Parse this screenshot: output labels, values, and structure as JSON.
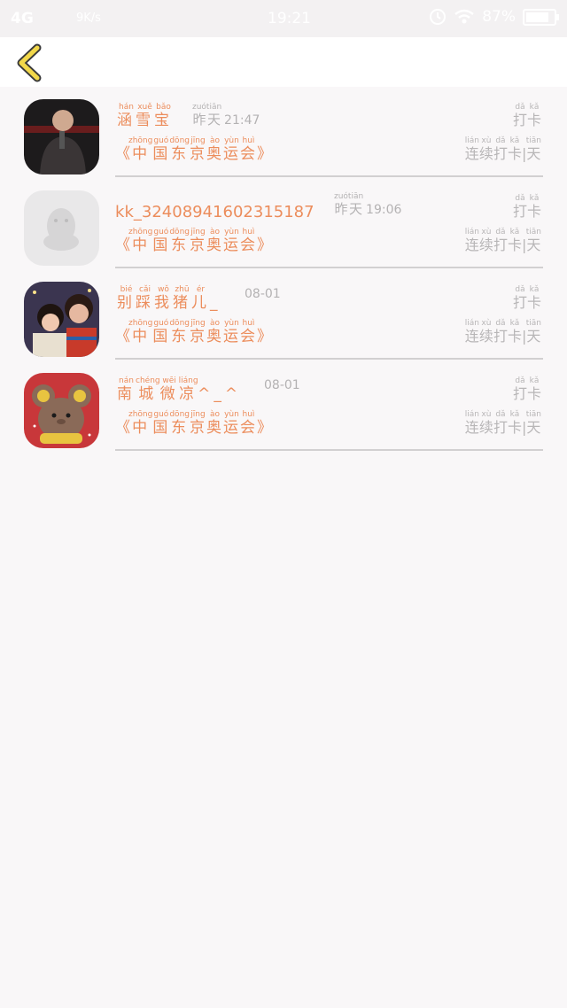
{
  "status_bar": {
    "network": "4G",
    "speed": "9K/s",
    "time": "19:21",
    "battery": "87%"
  },
  "colors": {
    "accent": "#ec8d5c",
    "gray_text": "#b8b6b7",
    "back_arrow": "#f2d84a"
  },
  "list": {
    "action_label": "打卡",
    "action_pinyin": [
      "dǎ",
      "kǎ"
    ],
    "streak_label": "连续打卡|天",
    "streak_pinyin": [
      "lián",
      "xù",
      "dǎ",
      "kǎ",
      "",
      "tiān"
    ],
    "items": [
      {
        "name": "涵雪宝",
        "name_pinyin": [
          "hán",
          "xuě",
          "bǎo"
        ],
        "date_word": "昨天",
        "date_pinyin": [
          "zuó",
          "tiān"
        ],
        "time": "21:47",
        "event": "《中国东京奥运会》",
        "event_pinyin": [
          "",
          "zhōng",
          "guó",
          "dōng",
          "jīng",
          "ào",
          "yùn",
          "huì",
          ""
        ],
        "avatar": "singer-photo"
      },
      {
        "name": "kk_3240894160231518​7",
        "name_pinyin": [],
        "date_word": "昨天",
        "date_pinyin": [
          "zuó",
          "tiān"
        ],
        "time": "19:06",
        "event": "《中国东京奥运会》",
        "event_pinyin": [
          "",
          "zhōng",
          "guó",
          "dōng",
          "jīng",
          "ào",
          "yùn",
          "huì",
          ""
        ],
        "avatar": "default-qq-penguin"
      },
      {
        "name": "别踩我猪儿_",
        "name_pinyin": [
          "bié",
          "cǎi",
          "wǒ",
          "zhū",
          "ér",
          ""
        ],
        "date_word": "",
        "date_pinyin": [],
        "time": "08-01",
        "event": "《中国东京奥运会》",
        "event_pinyin": [
          "",
          "zhōng",
          "guó",
          "dōng",
          "jīng",
          "ào",
          "yùn",
          "huì",
          ""
        ],
        "avatar": "two-kids-photo"
      },
      {
        "name": "南城微凉^_^",
        "name_pinyin": [
          "nán",
          "chéng",
          "wēi",
          "liáng",
          "",
          "",
          ""
        ],
        "date_word": "",
        "date_pinyin": [],
        "time": "08-01",
        "event": "《中国东京奥运会》",
        "event_pinyin": [
          "",
          "zhōng",
          "guó",
          "dōng",
          "jīng",
          "ào",
          "yùn",
          "huì",
          ""
        ],
        "avatar": "cartoon-mouse"
      }
    ]
  }
}
